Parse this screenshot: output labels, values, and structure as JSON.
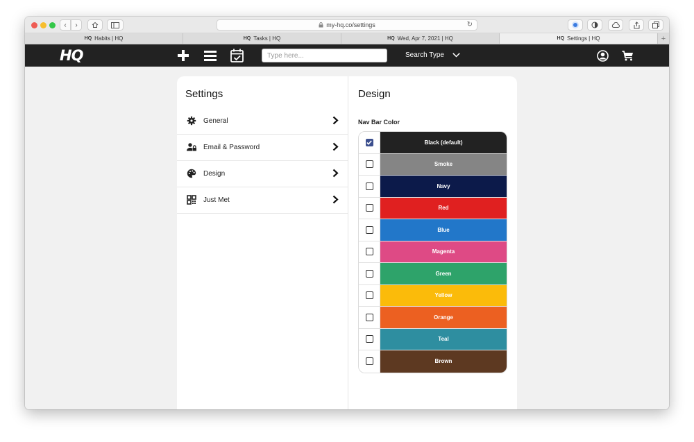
{
  "browser": {
    "url": "my-hq.co/settings",
    "tabs": [
      {
        "favicon": "HQ",
        "label": "Habits | HQ",
        "active": false
      },
      {
        "favicon": "HQ",
        "label": "Tasks | HQ",
        "active": false
      },
      {
        "favicon": "HQ",
        "label": "Wed, Apr 7, 2021 | HQ",
        "active": false
      },
      {
        "favicon": "HQ",
        "label": "Settings | HQ",
        "active": true
      }
    ],
    "new_tab": "+"
  },
  "navbar": {
    "logo": "HQ",
    "search_placeholder": "Type here...",
    "search_type_label": "Search Type",
    "icons": [
      "plus-icon",
      "menu-icon",
      "calendar-check-icon",
      "user-icon",
      "cart-icon"
    ]
  },
  "settings": {
    "title": "Settings",
    "items": [
      {
        "label": "General",
        "icon": "gear-icon"
      },
      {
        "label": "Email & Password",
        "icon": "user-lock-icon"
      },
      {
        "label": "Design",
        "icon": "palette-icon"
      },
      {
        "label": "Just Met",
        "icon": "qr-code-icon"
      }
    ]
  },
  "design": {
    "title": "Design",
    "nav_bar_color_label": "Nav Bar Color",
    "colors": [
      {
        "name": "Black (default)",
        "hex": "#222222",
        "checked": true
      },
      {
        "name": "Smoke",
        "hex": "#858585",
        "checked": false
      },
      {
        "name": "Navy",
        "hex": "#0c1a4a",
        "checked": false
      },
      {
        "name": "Red",
        "hex": "#e02020",
        "checked": false
      },
      {
        "name": "Blue",
        "hex": "#2277c9",
        "checked": false
      },
      {
        "name": "Magenta",
        "hex": "#de4a85",
        "checked": false
      },
      {
        "name": "Green",
        "hex": "#2ea36a",
        "checked": false
      },
      {
        "name": "Yellow",
        "hex": "#fbbb0a",
        "checked": false
      },
      {
        "name": "Orange",
        "hex": "#ec6021",
        "checked": false
      },
      {
        "name": "Teal",
        "hex": "#2e8ea0",
        "checked": false
      },
      {
        "name": "Brown",
        "hex": "#5d3921",
        "checked": false
      }
    ]
  }
}
